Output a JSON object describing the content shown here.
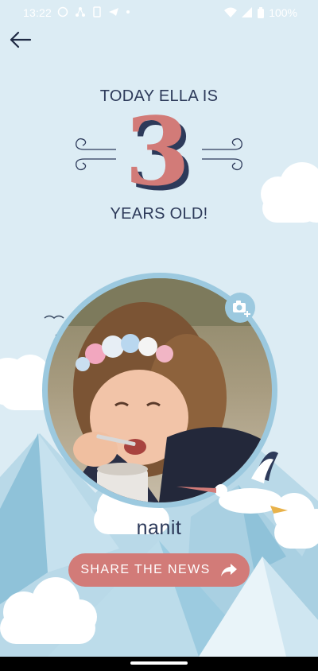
{
  "status_bar": {
    "time": "13:22",
    "battery": "100%"
  },
  "announcement": {
    "line1": "TODAY ELLA IS",
    "age": "3",
    "line2": "YEARS OLD!"
  },
  "brand": "nanit",
  "share_button": {
    "label": "SHARE THE NEWS"
  },
  "colors": {
    "background": "#dcecf4",
    "text": "#2d3a5a",
    "accent": "#d27b78",
    "ring": "#9cc9df"
  },
  "icons": {
    "back": "arrow-left-icon",
    "camera": "camera-add-icon",
    "share": "share-arrow-icon"
  }
}
